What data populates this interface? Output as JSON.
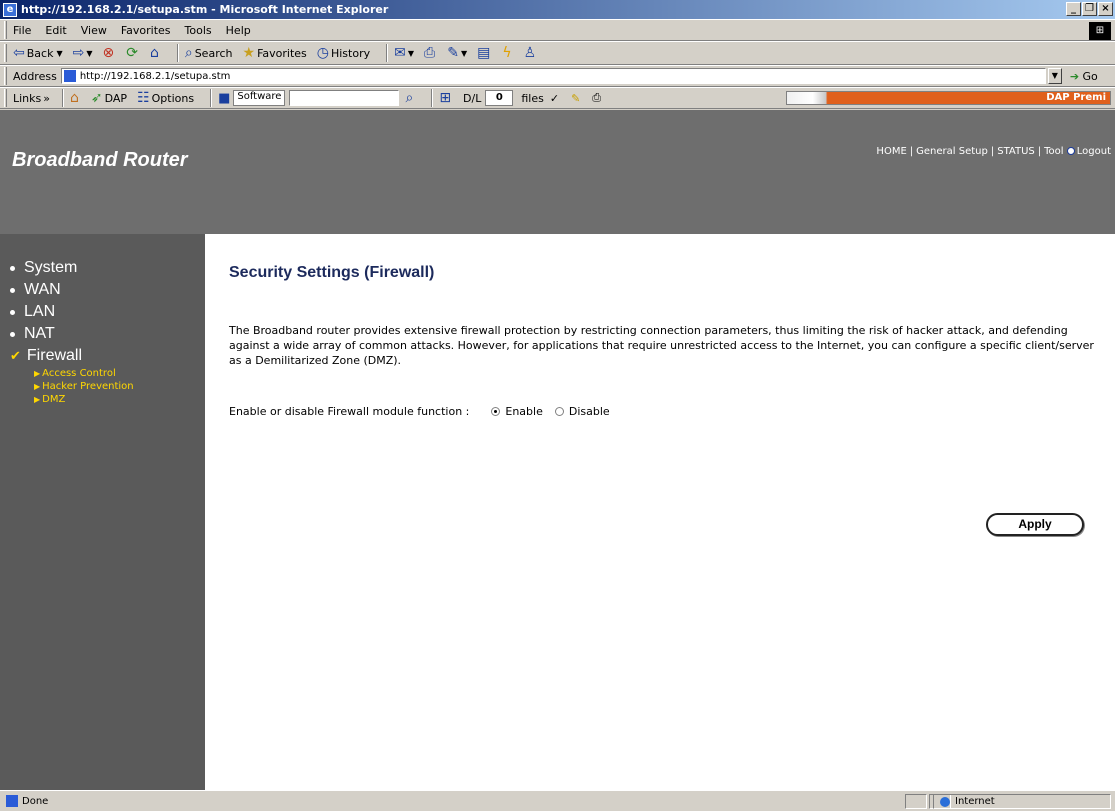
{
  "window": {
    "title": "http://192.168.2.1/setupa.stm - Microsoft Internet Explorer",
    "controls": [
      "_",
      "❐",
      "×"
    ]
  },
  "menubar": [
    "File",
    "Edit",
    "View",
    "Favorites",
    "Tools",
    "Help"
  ],
  "toolbar": {
    "back": "Back",
    "search": "Search",
    "favorites": "Favorites",
    "history": "History"
  },
  "addressbar": {
    "label": "Address",
    "url": "http://192.168.2.1/setupa.stm",
    "go": "Go"
  },
  "linksbar": {
    "links": "Links",
    "dap": "DAP",
    "options": "Options",
    "software": "Software",
    "dl_label": "D/L",
    "dl_count": "0",
    "files": "files",
    "dap_promo": "DAP Premi"
  },
  "page": {
    "brand": "Broadband Router",
    "nav": [
      "HOME",
      "General Setup",
      "STATUS",
      "Tool",
      "Logout"
    ],
    "sidebar": {
      "items": [
        "System",
        "WAN",
        "LAN",
        "NAT",
        "Firewall"
      ],
      "subitems": [
        "Access Control",
        "Hacker Prevention",
        "DMZ"
      ]
    },
    "heading": "Security Settings (Firewall)",
    "description": "The Broadband router provides extensive firewall protection by restricting connection parameters, thus limiting the risk of hacker attack, and defending against a wide array of common attacks. However, for applications that require unrestricted access to the Internet, you can configure a specific client/server as a Demilitarized Zone (DMZ).",
    "firewall_label": "Enable or disable Firewall module function :",
    "enable_label": "Enable",
    "disable_label": "Disable",
    "firewall_state": "Enable",
    "apply_label": "Apply"
  },
  "statusbar": {
    "status": "Done",
    "zone": "Internet"
  }
}
